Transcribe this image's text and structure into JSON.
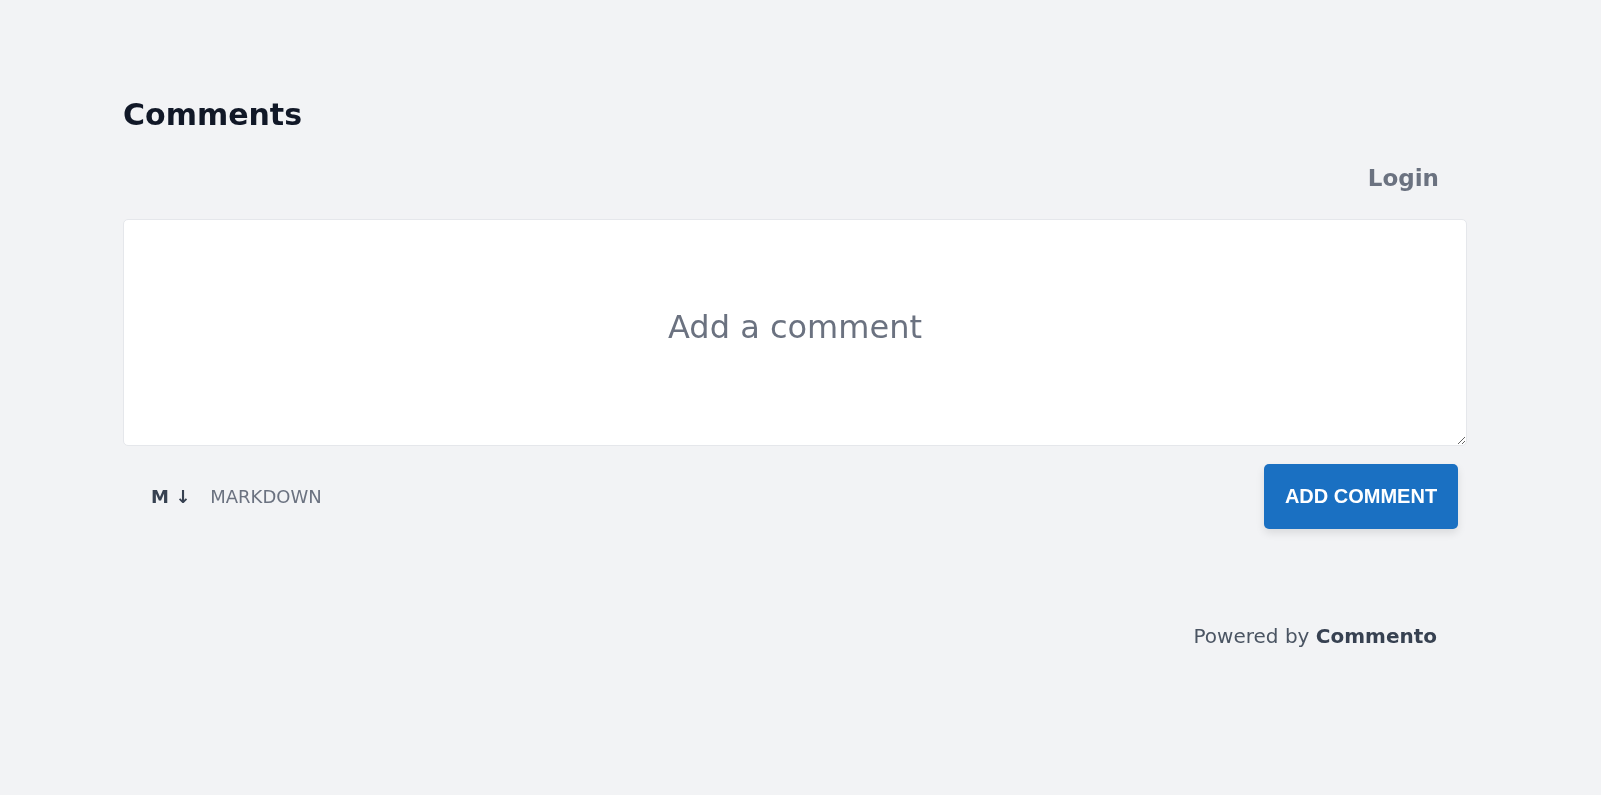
{
  "title": "Comments",
  "login": {
    "label": "Login"
  },
  "comment_box": {
    "placeholder": "Add a comment"
  },
  "markdown": {
    "logo": "M ↓",
    "label": "MARKDOWN"
  },
  "submit_button": {
    "label": "ADD COMMENT"
  },
  "footer": {
    "text": "Powered by **Commento**"
  }
}
